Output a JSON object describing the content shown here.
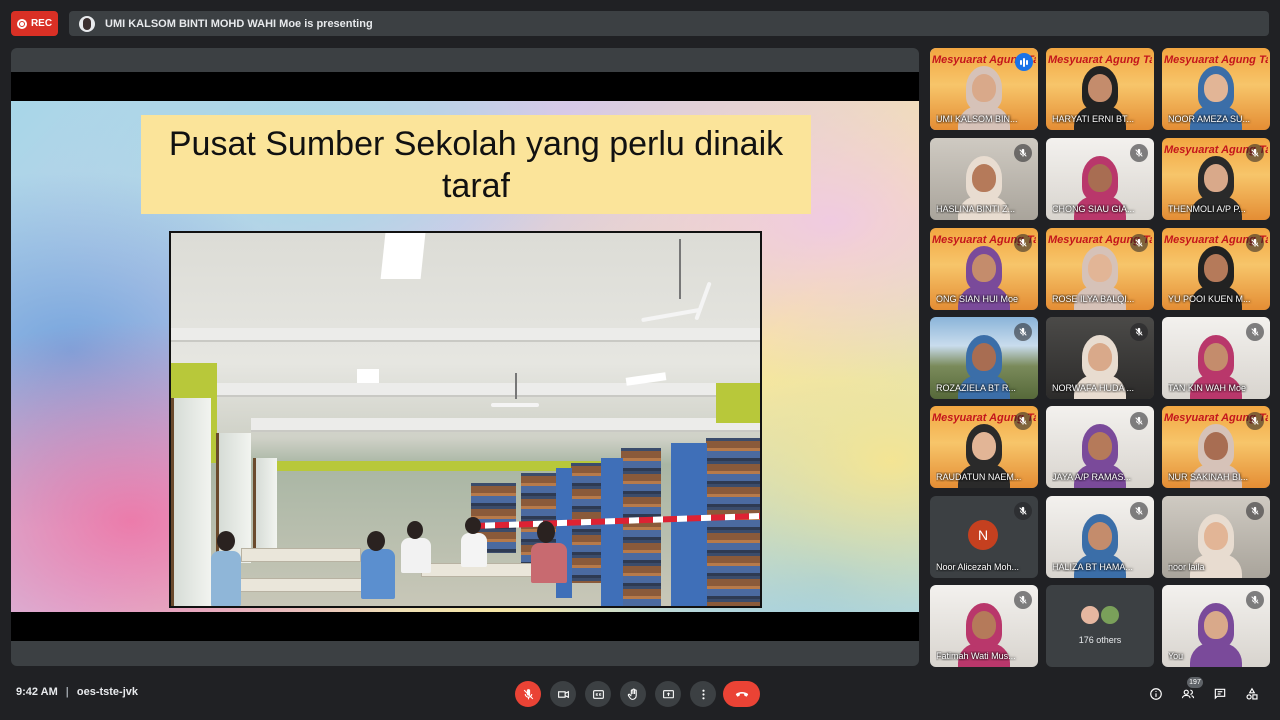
{
  "recording": {
    "label": "REC"
  },
  "presenter_bar": {
    "text": "UMI KALSOM BINTI MOHD WAHI Moe is presenting"
  },
  "slide": {
    "title": "Pusat Sumber Sekolah yang perlu dinaik taraf"
  },
  "participants": [
    {
      "name": "UMI KALSOM BIN...",
      "bg": "banner",
      "speaking": true
    },
    {
      "name": "HARYATI ERNI BT...",
      "bg": "banner"
    },
    {
      "name": "NOOR AMEZA SU...",
      "bg": "banner"
    },
    {
      "name": "HASLINA BINTI Z...",
      "bg": "room",
      "muted": true
    },
    {
      "name": "CHONG SIAU GIA...",
      "bg": "white",
      "muted": true
    },
    {
      "name": "THENMOLI A/P P...",
      "bg": "banner",
      "muted": true
    },
    {
      "name": "ONG SIAN HUI Moe",
      "bg": "banner",
      "muted": true
    },
    {
      "name": "ROSE ILYA BALQI...",
      "bg": "banner",
      "muted": true
    },
    {
      "name": "YU POOI KUEN M...",
      "bg": "banner",
      "muted": true
    },
    {
      "name": "ROZAZIELA BT R...",
      "bg": "mount",
      "muted": true
    },
    {
      "name": "NORWAFA HUDA ...",
      "bg": "dark",
      "muted": true
    },
    {
      "name": "TAN KIN WAH Moe",
      "bg": "white",
      "muted": true
    },
    {
      "name": "RAUDATUN NAEM...",
      "bg": "banner",
      "muted": true
    },
    {
      "name": "JAYA A/P RAMAS...",
      "bg": "white",
      "muted": true
    },
    {
      "name": "NUR SAKINAH BI...",
      "bg": "banner",
      "muted": true
    },
    {
      "name": "Noor Alicezah Moh...",
      "bg": "avatar",
      "initial": "N",
      "muted": true
    },
    {
      "name": "HALIZA BT HAMA...",
      "bg": "white",
      "muted": true
    },
    {
      "name": "noor laila",
      "bg": "room",
      "muted": true
    },
    {
      "name": "Fatimah Wati Mus...",
      "bg": "white",
      "muted": true
    },
    {
      "name": "176 others",
      "bg": "others"
    },
    {
      "name": "You",
      "bg": "white",
      "muted": true
    }
  ],
  "banner_text": "Mesyuarat Agung Tahun",
  "meeting": {
    "time": "9:42 AM",
    "separator": "|",
    "code": "oes-tste-jvk"
  },
  "people_count": "197",
  "colors": {
    "end_call": "#ea4335",
    "accent": "#8ab4f8",
    "rec": "#d93025"
  }
}
